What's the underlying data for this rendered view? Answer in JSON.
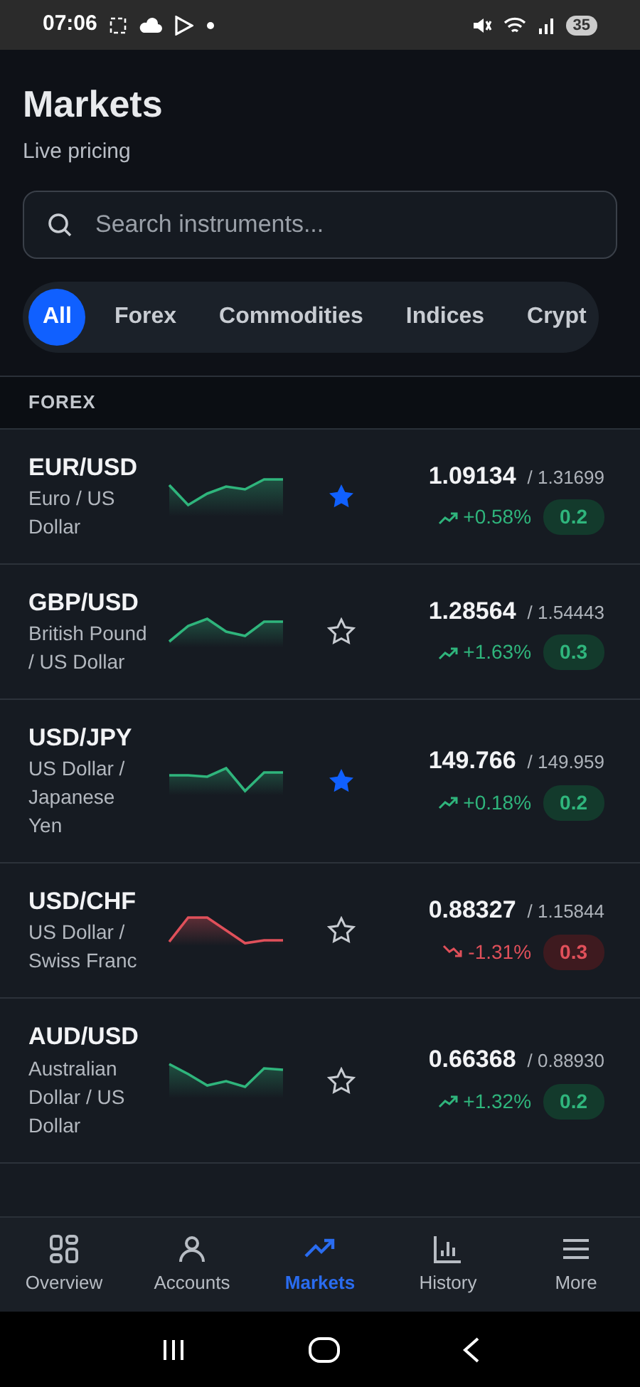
{
  "status_bar": {
    "time": "07:06",
    "battery": "35"
  },
  "header": {
    "title": "Markets",
    "subtitle": "Live pricing"
  },
  "search": {
    "placeholder": "Search instruments..."
  },
  "filters": [
    {
      "label": "All",
      "selected": true
    },
    {
      "label": "Forex",
      "selected": false
    },
    {
      "label": "Commodities",
      "selected": false
    },
    {
      "label": "Indices",
      "selected": false
    },
    {
      "label": "Crypt",
      "selected": false
    }
  ],
  "section": {
    "title": "FOREX"
  },
  "instruments": [
    {
      "symbol": "EUR/USD",
      "name": "Euro / US Dollar",
      "favorite": true,
      "price": "1.09134",
      "price_2": "/ 1.31699",
      "rising": true,
      "change": "+0.58%",
      "spread": "0.2"
    },
    {
      "symbol": "GBP/USD",
      "name": "British Pound / US Dollar",
      "favorite": false,
      "price": "1.28564",
      "price_2": "/ 1.54443",
      "rising": true,
      "change": "+1.63%",
      "spread": "0.3"
    },
    {
      "symbol": "USD/JPY",
      "name": "US Dollar / Japanese Yen",
      "favorite": true,
      "price": "149.766",
      "price_2": "/ 149.959",
      "rising": true,
      "change": "+0.18%",
      "spread": "0.2"
    },
    {
      "symbol": "USD/CHF",
      "name": "US Dollar / Swiss Franc",
      "favorite": false,
      "price": "0.88327",
      "price_2": "/ 1.15844",
      "rising": false,
      "change": "-1.31%",
      "spread": "0.3"
    },
    {
      "symbol": "AUD/USD",
      "name": "Australian Dollar / US Dollar",
      "favorite": false,
      "price": "0.66368",
      "price_2": "/ 0.88930",
      "rising": true,
      "change": "+1.32%",
      "spread": "0.2"
    }
  ],
  "bottom_nav": [
    {
      "kind": "grid",
      "label": "Overview",
      "selected": false
    },
    {
      "kind": "person",
      "label": "Accounts",
      "selected": false
    },
    {
      "kind": "trend",
      "label": "Markets",
      "selected": true
    },
    {
      "kind": "bars",
      "label": "History",
      "selected": false
    },
    {
      "kind": "menu",
      "label": "More",
      "selected": false
    }
  ]
}
